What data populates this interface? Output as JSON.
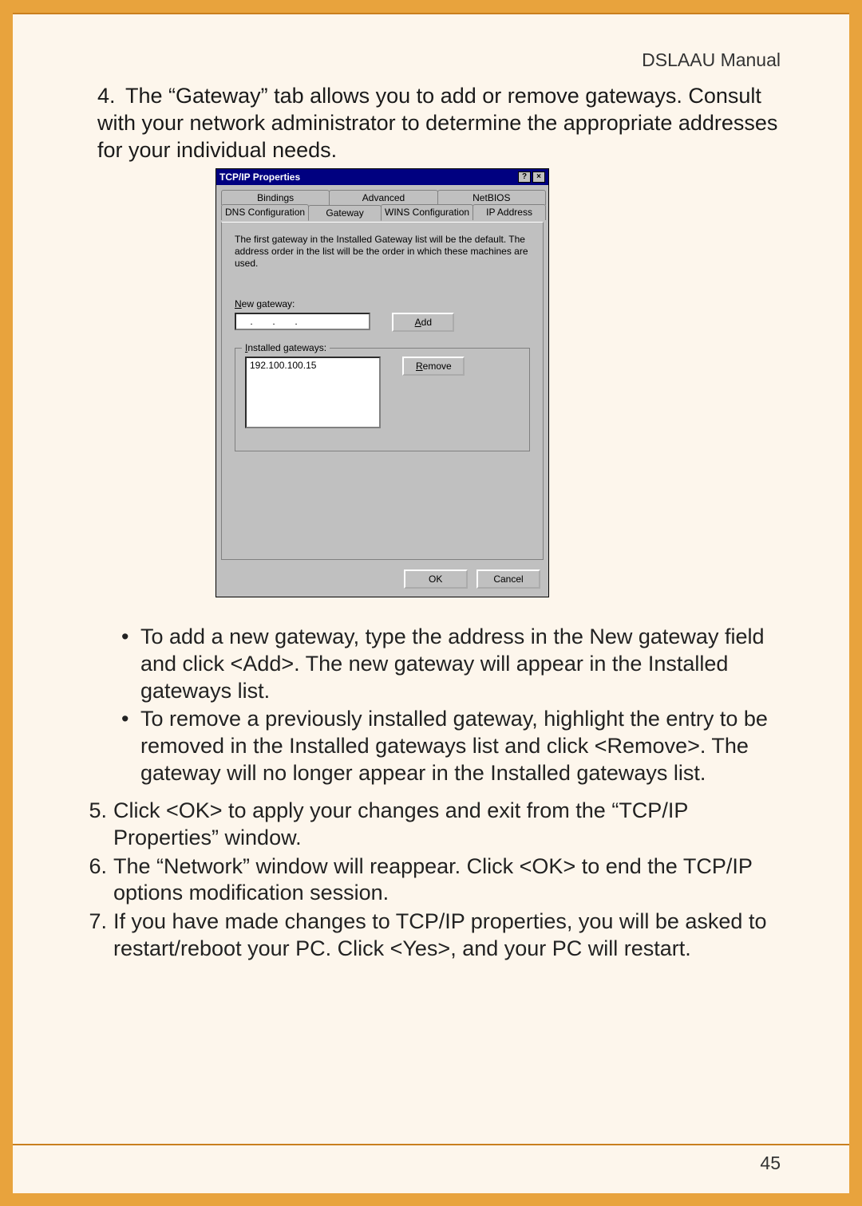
{
  "header": {
    "manual_title": "DSLAAU Manual"
  },
  "step4": {
    "number": "4.",
    "text": "The “Gateway” tab allows you to add or remove gateways. Consult with your network administrator to determine the appropriate addresses for your individual needs."
  },
  "dialog": {
    "title": "TCP/IP Properties",
    "help_btn": "?",
    "close_btn": "×",
    "tabs_row1": [
      "Bindings",
      "Advanced",
      "NetBIOS"
    ],
    "tabs_row2": [
      "DNS Configuration",
      "Gateway",
      "WINS Configuration",
      "IP Address"
    ],
    "active_tab": "Gateway",
    "description": "The first gateway in the Installed Gateway list will be the default. The address order in the list will be the order in which these machines are used.",
    "new_gateway_label": "New gateway:",
    "ip_dots": ".       .       .",
    "add_label": "Add",
    "installed_label": "Installed gateways:",
    "installed_value": "192.100.100.15",
    "remove_label": "Remove",
    "ok_label": "OK",
    "cancel_label": "Cancel"
  },
  "bullets": {
    "b1": "To add a new gateway, type the address in the New gateway field and click <Add>. The new gateway will appear in the Installed gateways list.",
    "b2": "To remove a previously installed gateway, highlight the entry to be removed in the Installed gateways list and click <Remove>. The gateway will no longer appear in the Installed gateways list."
  },
  "step5": {
    "n": "5.",
    "t": "Click <OK> to apply your changes and exit from the “TCP/IP Properties” window."
  },
  "step6": {
    "n": "6.",
    "t": "The “Network” window will reappear. Click <OK> to end the TCP/IP options modification session."
  },
  "step7": {
    "n": "7.",
    "t": "If you have made changes to TCP/IP properties, you will be asked to restart/reboot your PC. Click <Yes>, and your PC will restart."
  },
  "page_number": "45"
}
